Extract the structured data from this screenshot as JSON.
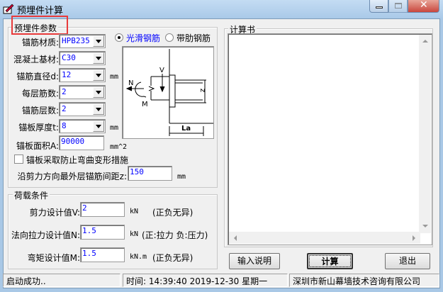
{
  "window": {
    "title": "预埋件计算",
    "icon": "app-pen-icon"
  },
  "params": {
    "group_label": "预埋件参数",
    "material": {
      "label": "锚筋材质:",
      "value": "HPB235"
    },
    "concrete": {
      "label": "混凝土基材:",
      "value": "C30"
    },
    "diameter": {
      "label": "锚筋直径d:",
      "value": "12",
      "unit": "mm"
    },
    "per_layer": {
      "label": "每层筋数:",
      "value": "2"
    },
    "layers": {
      "label": "锚筋层数:",
      "value": "2"
    },
    "thickness": {
      "label": "锚板厚度t:",
      "value": "8",
      "unit": "mm"
    },
    "area": {
      "label": "锚板面积A:",
      "value": "90000",
      "unit": "mm^2"
    },
    "radio_smooth": "光滑钢筋",
    "radio_ribbed": "带肋钢筋",
    "selected_bar": "光滑钢筋",
    "checkbox_label": "锚板采取防止弯曲变形措施",
    "checkbox_checked": false,
    "spacing": {
      "label": "沿剪力方向最外层锚筋间距z:",
      "value": "150",
      "unit": "mm"
    },
    "diagram": {
      "v": "V",
      "n": "N",
      "m": "M",
      "z": "z",
      "la": "La"
    }
  },
  "loads": {
    "group_label": "荷载条件",
    "shear": {
      "label": "剪力设计值V:",
      "value": "2",
      "unit": "kN",
      "note": "(正负无异)"
    },
    "tension": {
      "label": "法向拉力设计值N:",
      "value": "1.5",
      "unit": "kN",
      "note": "(正:拉力 负:压力)"
    },
    "moment": {
      "label": "弯矩设计值M:",
      "value": "1.5",
      "unit": "kN.m",
      "note": "(正负无异)"
    }
  },
  "report": {
    "group_label": "计算书",
    "content": ""
  },
  "buttons": {
    "help": "输入说明",
    "calc": "计算",
    "exit": "退出"
  },
  "statusbar": {
    "status": "启动成功..",
    "time": "时间: 14:39:40 2019-12-30 星期一",
    "company": "深圳市新山幕墙技术咨询有限公司"
  },
  "colors": {
    "value_text": "#0000ff",
    "highlight_box": "#e83a3a",
    "close_button": "#c9463d"
  }
}
